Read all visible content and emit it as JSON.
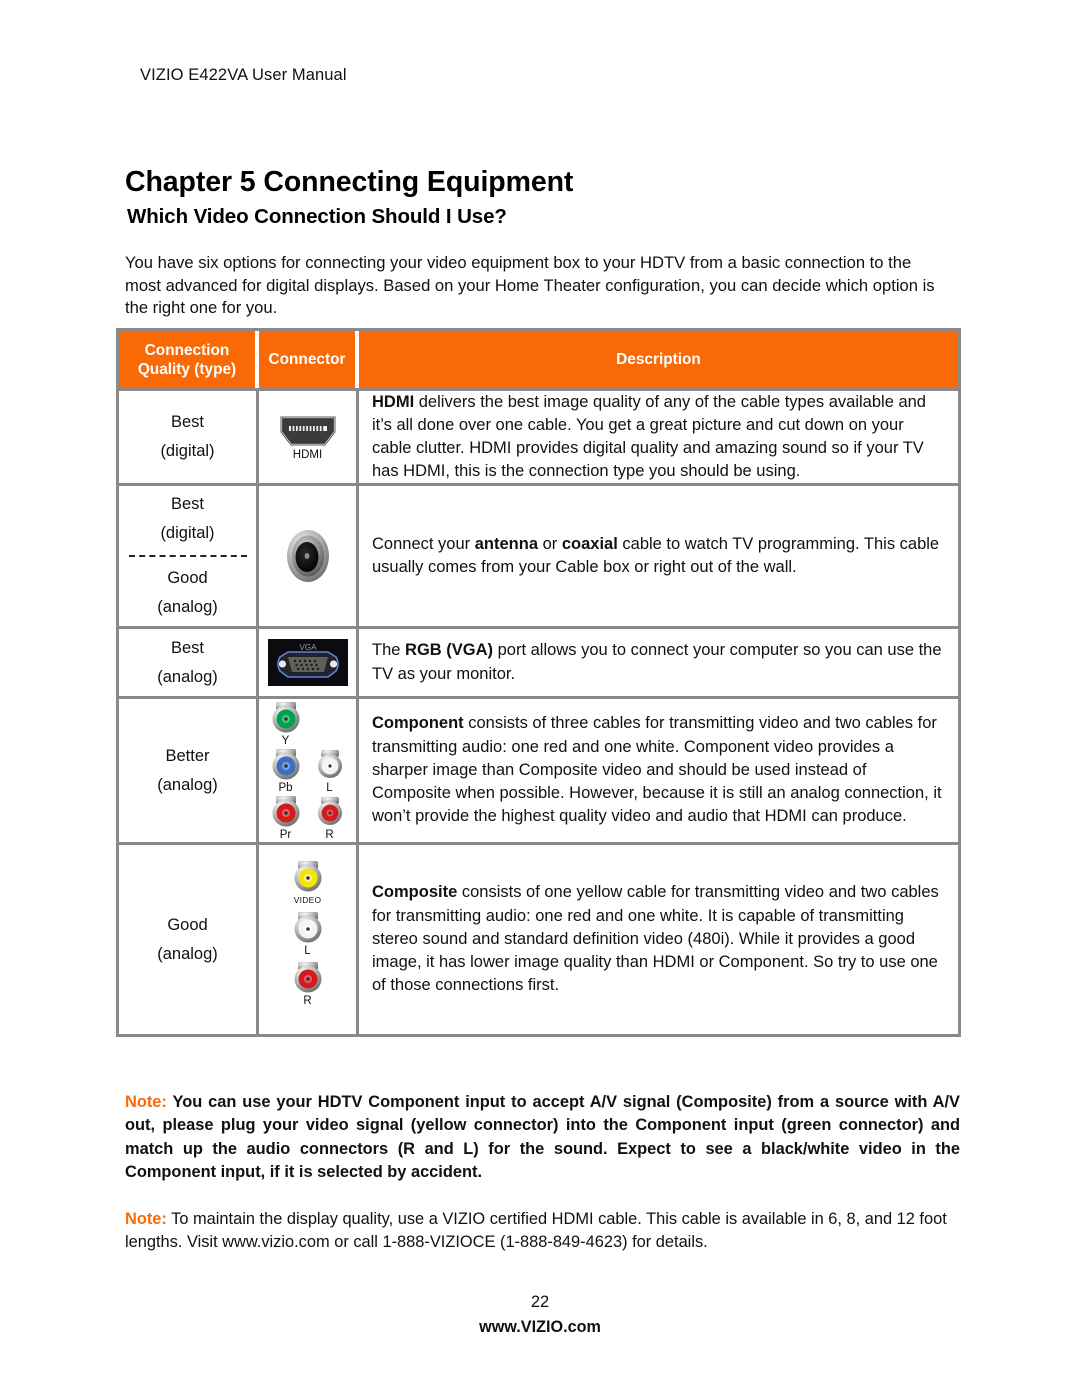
{
  "document": {
    "running_header": "VIZIO E422VA User Manual",
    "chapter_title": "Chapter 5 Connecting Equipment",
    "section_title": "Which Video Connection Should I Use?",
    "intro_paragraph": "You have six options for connecting your video equipment box to your HDTV from a basic connection to the most advanced for digital displays. Based on your Home Theater configuration, you can decide which option is the right one for you.",
    "page_number": "22",
    "footer_url": "www.VIZIO.com"
  },
  "colors": {
    "accent_orange": "#f96a06",
    "table_border_gray": "#8a8a8a",
    "header_text": "#ffffff",
    "connector_green": "#00a14b",
    "connector_blue": "#3a6fc4",
    "connector_red": "#d31b1b",
    "connector_yellow": "#f5e400",
    "connector_white": "#f4f4f4",
    "vga_blue": "#5b86d6"
  },
  "table": {
    "headers": {
      "quality": "Connection Quality (type)",
      "quality_line1": "Connection",
      "quality_line2": "Quality (type)",
      "connector": "Connector",
      "description": "Description"
    },
    "rows": [
      {
        "id": "hdmi",
        "quality_lines": [
          "Best",
          "(digital)"
        ],
        "divider": false,
        "connector_icon": "hdmi-port-icon",
        "connector_label": "HDMI",
        "description_lead": "HDMI",
        "description_rest": " delivers the best image quality of any of the cable types available and it’s all done over one cable. You get a great picture and cut down on your cable clutter. HDMI provides digital quality and amazing sound so if your TV has HDMI, this is the connection type you should be using."
      },
      {
        "id": "coaxial",
        "quality_lines": [
          "Best",
          "(digital)"
        ],
        "quality_lines_lower": [
          "Good",
          "(analog)"
        ],
        "divider": true,
        "connector_icon": "coaxial-jack-icon",
        "connector_label": "",
        "description_prefix": "Connect your ",
        "description_bold1": "antenna",
        "description_mid": " or ",
        "description_bold2": "coaxial",
        "description_suffix": " cable to watch TV programming. This cable usually comes from your Cable box or right out of the wall."
      },
      {
        "id": "vga",
        "quality_lines": [
          "Best",
          "(analog)"
        ],
        "divider": false,
        "connector_icon": "vga-port-icon",
        "connector_label": "VGA",
        "description_prefix": "The ",
        "description_bold1": "RGB (VGA)",
        "description_suffix": " port allows you to connect your computer so you can use the TV as your monitor."
      },
      {
        "id": "component",
        "quality_lines": [
          "Better",
          "(analog)"
        ],
        "divider": false,
        "connector_icon": "component-jacks-icon",
        "jack_labels": [
          "Y",
          "Pb",
          "L",
          "Pr",
          "R"
        ],
        "description_lead": "Component",
        "description_rest": " consists of three cables for transmitting video and two cables for transmitting audio: one red and one white. Component video provides a sharper image than Composite video and should be used instead of Composite when possible. However, because it is still an analog connection, it won’t provide the highest quality video and audio that HDMI can produce."
      },
      {
        "id": "composite",
        "quality_lines": [
          "Good",
          "(analog)"
        ],
        "divider": false,
        "connector_icon": "composite-jacks-icon",
        "jack_labels": [
          "VIDEO",
          "L",
          "R"
        ],
        "description_lead": "Composite",
        "description_rest": " consists of one yellow cable for transmitting video and two cables for transmitting audio: one red and one white. It is capable of transmitting stereo sound and standard definition video (480i). While it provides a good image, it has lower image quality than HDMI or Component. So try to use one of those connections first."
      }
    ]
  },
  "notes": [
    {
      "label": "Note:",
      "text": "You can use your HDTV Component input to accept A/V signal (Composite) from a source with A/V out, please plug your video signal (yellow connector) into the Component input (green connector) and match up the audio connectors (R and L) for the sound. Expect to see a black/white video in the Component input, if it is selected by accident."
    },
    {
      "label": "Note:",
      "text": "To maintain the display quality, use a VIZIO certified HDMI cable. This cable is available in 6, 8, and 12 foot lengths. Visit www.vizio.com or call 1-888-VIZIOCE (1-888-849-4623) for details."
    }
  ]
}
